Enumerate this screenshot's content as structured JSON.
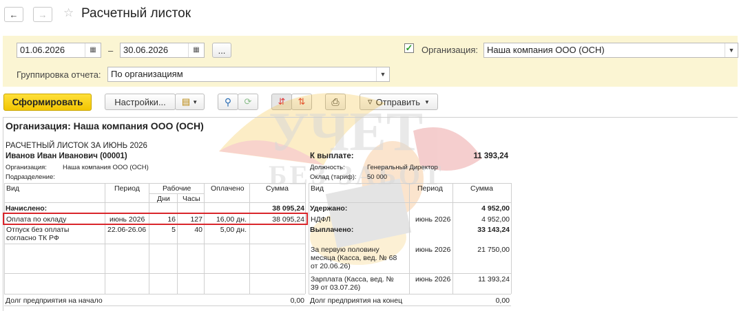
{
  "window": {
    "title": "Расчетный листок"
  },
  "filters": {
    "date_from": "01.06.2026",
    "date_sep": "–",
    "date_to": "30.06.2026",
    "period_btn": "...",
    "org_label": "Организация:",
    "org_value": "Наша компания ООО (ОСН)",
    "org_checked": true,
    "group_label": "Группировка отчета:",
    "group_value": "По организациям"
  },
  "toolbar": {
    "generate": "Сформировать",
    "settings": "Настройки...",
    "send": "Отправить"
  },
  "watermark": {
    "line1": "УЧЕТ",
    "line2": "БЕЗ ЗАБОТ"
  },
  "report": {
    "org_header": "Организация: Наша компания ООО (ОСН)",
    "title": "РАСЧЕТНЫЙ ЛИСТОК ЗА ИЮНЬ 2026",
    "employee": "Иванов Иван Иванович (00001)",
    "org_line_label": "Организация:",
    "org_line_value": "Наша компания ООО (ОСН)",
    "dept_label": "Подразделение:",
    "pay_label": "К выплате:",
    "pay_value": "11 393,24",
    "position_label": "Должность:",
    "position_value": "Генеральный Директор",
    "salary_label": "Оклад (тариф):",
    "salary_value": "50 000",
    "left_headers": {
      "kind": "Вид",
      "period": "Период",
      "work": "Рабочие",
      "days": "Дни",
      "hours": "Часы",
      "paid": "Оплачено",
      "sum": "Сумма"
    },
    "right_headers": {
      "kind": "Вид",
      "period": "Период",
      "sum": "Сумма"
    },
    "accrued_label": "Начислено:",
    "accrued_total": "38 095,24",
    "accruals": [
      {
        "kind": "Оплата по окладу",
        "period": "июнь 2026",
        "days": "16",
        "hours": "127",
        "paid": "16,00 дн.",
        "sum": "38 095,24"
      },
      {
        "kind": "Отпуск без оплаты согласно ТК РФ",
        "kind1": "Отпуск без оплаты",
        "kind2": "согласно ТК РФ",
        "period": "22.06-26.06",
        "days": "5",
        "hours": "40",
        "paid": "5,00 дн.",
        "sum": ""
      }
    ],
    "withheld_label": "Удержано:",
    "withheld_total": "4 952,00",
    "withholdings": [
      {
        "kind": "НДФЛ",
        "period": "июнь 2026",
        "sum": "4 952,00"
      }
    ],
    "paid_label": "Выплачено:",
    "paid_total": "33 143,24",
    "payments": [
      {
        "kind1": "За первую половину",
        "kind2": "месяца (Касса, вед. № 68",
        "kind3": "от 20.06.26)",
        "period": "июнь 2026",
        "sum": "21 750,00"
      },
      {
        "kind1": "Зарплата (Касса, вед. №",
        "kind2": "39 от 03.07.26)",
        "period": "июнь 2026",
        "sum": "11 393,24"
      }
    ],
    "debt_start_label": "Долг предприятия на начало",
    "debt_start_value": "0,00",
    "debt_end_label": "Долг предприятия на конец",
    "debt_end_value": "0,00"
  },
  "colors": {
    "panel_bg": "#fbf5d3",
    "primary_btn": "#f2c500",
    "highlight_border": "#d9252a"
  }
}
